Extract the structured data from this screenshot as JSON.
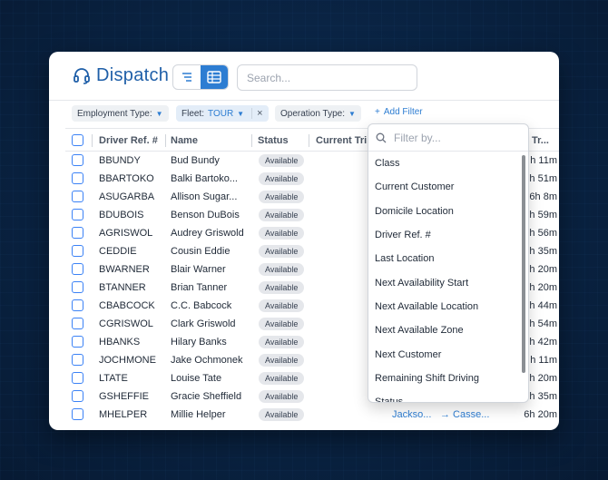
{
  "app": {
    "title": "Dispatch"
  },
  "search": {
    "placeholder": "Search..."
  },
  "filters": {
    "employment_type": "Employment Type:",
    "fleet_label": "Fleet:",
    "fleet_value": "TOUR",
    "operation_type": "Operation Type:",
    "add_filter": "Add Filter"
  },
  "columns": {
    "driver_ref": "Driver Ref. #",
    "name": "Name",
    "status": "Status",
    "current_trip": "Current Tri",
    "time_remaining": "Tr..."
  },
  "rows": [
    {
      "ref": "BBUNDY",
      "name": "Bud Bundy",
      "status": "Available",
      "time": "h 11m"
    },
    {
      "ref": "BBARTOKO",
      "name": "Balki Bartoko...",
      "status": "Available",
      "time": "h 51m"
    },
    {
      "ref": "ASUGARBA",
      "name": "Allison Sugar...",
      "status": "Available",
      "time": "6h 8m"
    },
    {
      "ref": "BDUBOIS",
      "name": "Benson DuBois",
      "status": "Available",
      "time": "h 59m"
    },
    {
      "ref": "AGRISWOL",
      "name": "Audrey Griswold",
      "status": "Available",
      "time": "h 56m"
    },
    {
      "ref": "CEDDIE",
      "name": "Cousin Eddie",
      "status": "Available",
      "time": "h 35m"
    },
    {
      "ref": "BWARNER",
      "name": "Blair Warner",
      "status": "Available",
      "time": "h 20m"
    },
    {
      "ref": "BTANNER",
      "name": "Brian Tanner",
      "status": "Available",
      "time": "h 20m"
    },
    {
      "ref": "CBABCOCK",
      "name": "C.C. Babcock",
      "status": "Available",
      "time": "h 44m"
    },
    {
      "ref": "CGRISWOL",
      "name": "Clark Griswold",
      "status": "Available",
      "time": "h 54m"
    },
    {
      "ref": "HBANKS",
      "name": "Hilary Banks",
      "status": "Available",
      "time": "h 42m"
    },
    {
      "ref": "JOCHMONE",
      "name": "Jake Ochmonek",
      "status": "Available",
      "time": "h 11m"
    },
    {
      "ref": "LTATE",
      "name": "Louise Tate",
      "status": "Available",
      "time": "h 20m"
    },
    {
      "ref": "GSHEFFIE",
      "name": "Gracie Sheffield",
      "status": "Available",
      "time": "h 35m"
    },
    {
      "ref": "MHELPER",
      "name": "Millie Helper",
      "status": "Available",
      "time": "6h 20m",
      "trip_from": "Jackso...",
      "trip_to": "→ Casse..."
    }
  ],
  "dropdown": {
    "placeholder": "Filter by...",
    "items": [
      "Class",
      "Current Customer",
      "Domicile Location",
      "Driver Ref. #",
      "Last Location",
      "Next Availability Start",
      "Next Available Location",
      "Next Available Zone",
      "Next Customer",
      "Remaining Shift Driving",
      "Status"
    ]
  },
  "colors": {
    "brand": "#1f5fa8",
    "accent": "#2d7dd2",
    "background": "#0a2546"
  }
}
